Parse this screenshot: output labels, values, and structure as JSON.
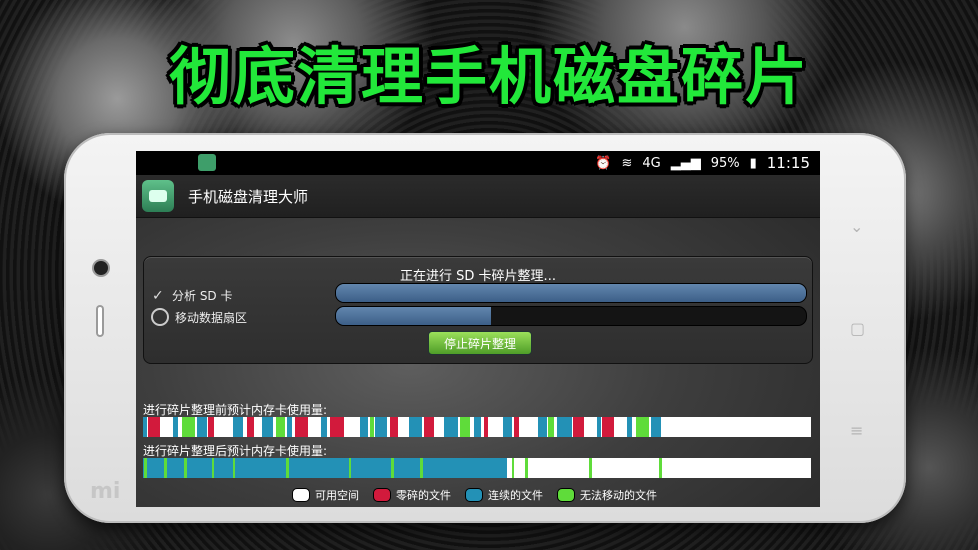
{
  "headline": "彻底清理手机磁盘碎片",
  "status": {
    "network": "4G",
    "battery": "95%",
    "time": "11:15"
  },
  "app": {
    "title": "手机磁盘清理大师"
  },
  "progress": {
    "title": "正在进行 SD 卡碎片整理...",
    "steps": [
      {
        "label": "分析 SD 卡",
        "done": true,
        "progress": 1.0
      },
      {
        "label": "移动数据扇区",
        "done": false,
        "progress": 0.33
      }
    ],
    "stop_button": "停止碎片整理"
  },
  "maps": {
    "before_label": "进行碎片整理前预计内存卡使用量:",
    "after_label": "进行碎片整理后预计内存卡使用量:"
  },
  "legend": [
    {
      "label": "可用空间",
      "color": "#ffffff"
    },
    {
      "label": "零碎的文件",
      "color": "#d21a3c"
    },
    {
      "label": "连续的文件",
      "color": "#2391b6"
    },
    {
      "label": "无法移动的文件",
      "color": "#5fdc3a"
    }
  ],
  "colors": {
    "accent": "#22e83a",
    "free": "#ffffff",
    "fragmented": "#d21a3c",
    "contiguous": "#2391b6",
    "unmovable": "#5fdc3a"
  }
}
